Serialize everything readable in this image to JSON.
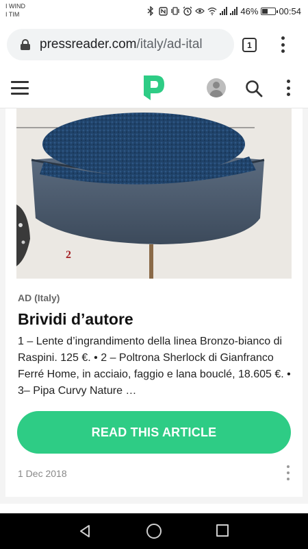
{
  "status_bar": {
    "carrier_1": "I WIND",
    "carrier_2": "I TIM",
    "battery_percent": "46%",
    "battery_level": 0.46,
    "time": "00:54",
    "icons": [
      "bluetooth-icon",
      "nfc-icon",
      "vibrate-icon",
      "alarm-icon",
      "eye-comfort-icon",
      "wifi-icon",
      "signal-icon",
      "battery-icon"
    ]
  },
  "browser": {
    "url_host": "pressreader.com",
    "url_path": "/italy/ad-ital",
    "tab_count": "1"
  },
  "app_header": {
    "logo": "pressreader-logo",
    "brand_color": "#2ecc85"
  },
  "article": {
    "hero_caption_number": "2",
    "publication": "AD (Italy)",
    "title": "Brividi d’autore",
    "excerpt": "1 – Lente d’ingrandimento della linea Bronzo-bianco di Raspini. 125 €. • 2 – Poltrona Sherlock di Gianfranco Ferré Home, in acciaio, faggio e lana bouclé, 18.605 €. • 3– Pipa Curvy Nature …",
    "cta_label": "READ THIS ARTICLE",
    "date": "1 Dec 2018"
  },
  "colors": {
    "accent": "#2ecc85",
    "text": "#111111",
    "muted": "#888888"
  }
}
